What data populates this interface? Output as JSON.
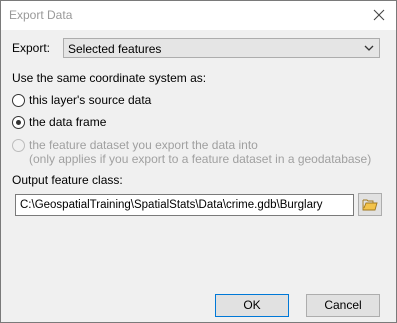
{
  "window": {
    "title": "Export Data"
  },
  "export": {
    "label": "Export:",
    "selected": "Selected features"
  },
  "coordinate": {
    "heading": "Use the same coordinate system as:",
    "options": [
      {
        "label": "this layer's source data",
        "checked": false,
        "enabled": true
      },
      {
        "label": "the data frame",
        "checked": true,
        "enabled": true
      },
      {
        "label": "the feature dataset you export the data into",
        "sublabel": "(only applies if you export to a feature dataset in a geodatabase)",
        "checked": false,
        "enabled": false
      }
    ]
  },
  "output": {
    "label": "Output feature class:",
    "value": "C:\\GeospatialTraining\\SpatialStats\\Data\\crime.gdb\\Burglary"
  },
  "buttons": {
    "ok": "OK",
    "cancel": "Cancel"
  },
  "icons": {
    "close": "close-icon",
    "browse": "open-folder-icon",
    "dropdown": "chevron-down-icon"
  }
}
